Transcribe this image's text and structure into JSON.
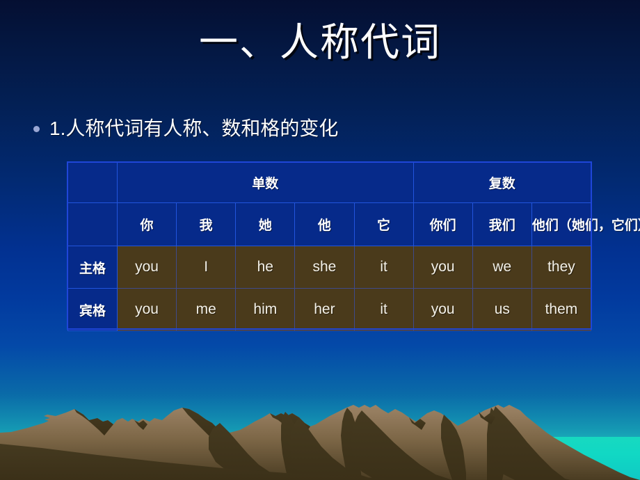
{
  "slide": {
    "title": "一、人称代词",
    "bullet": {
      "marker": "bullet-dot",
      "text": "1.人称代词有人称、数和格的变化"
    }
  },
  "table": {
    "corner_label": "",
    "group_headers": [
      {
        "label": "单数",
        "span": 5
      },
      {
        "label": "复数",
        "span": 3
      }
    ],
    "person_headers": [
      "你",
      "我",
      "她",
      "他",
      "它",
      "你们",
      "我们",
      "他们（她们，它们）"
    ],
    "rows": [
      {
        "case_label": "主格",
        "values": [
          "you",
          "I",
          "he",
          "she",
          "it",
          "you",
          "we",
          "they"
        ]
      },
      {
        "case_label": "宾格",
        "values": [
          "you",
          "me",
          "him",
          "her",
          "it",
          "you",
          "us",
          "them"
        ]
      }
    ]
  },
  "colors": {
    "sky_top": "#050f32",
    "sky_mid": "#023191",
    "sky_bottom": "#23d6c6",
    "sea": "#17d9c0",
    "table_cell_blue": "#062a8a",
    "table_border": "#2255dd",
    "data_cell_brown": "#4a3a1b",
    "mountain_light": "#8d7558",
    "mountain_dark": "#453a20",
    "text_white": "#ffffff",
    "bullet_dot": "#9aa7d4"
  }
}
